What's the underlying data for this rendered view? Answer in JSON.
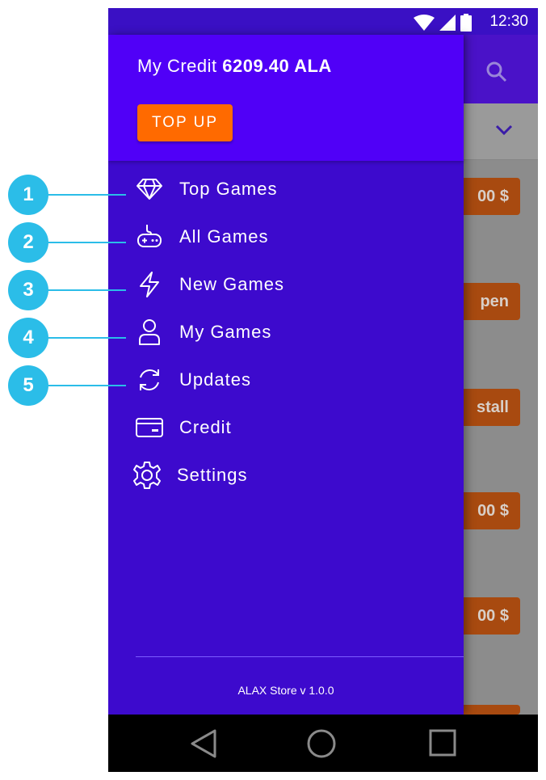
{
  "status_bar": {
    "time": "12:30"
  },
  "drawer": {
    "credit_label": "My Credit",
    "credit_amount": "6209.40 ALA",
    "top_up_label": "TOP UP",
    "menu_items": [
      {
        "label": "Top Games",
        "icon": "diamond-icon"
      },
      {
        "label": "All Games",
        "icon": "gamepad-icon"
      },
      {
        "label": "New Games",
        "icon": "lightning-icon"
      },
      {
        "label": "My Games",
        "icon": "person-icon"
      },
      {
        "label": "Updates",
        "icon": "refresh-icon"
      },
      {
        "label": "Credit",
        "icon": "card-icon"
      },
      {
        "label": "Settings",
        "icon": "gear-icon"
      }
    ],
    "version": "ALAX Store v 1.0.0"
  },
  "background_list": {
    "buttons": [
      "00 $",
      "pen",
      "stall",
      "00 $",
      "00 $"
    ]
  },
  "callouts": [
    "1",
    "2",
    "3",
    "4",
    "5"
  ],
  "colors": {
    "drawer_header": "#5000f7",
    "drawer_body": "#3d0acd",
    "accent_button": "#ff6a00",
    "callout": "#2bbde8"
  }
}
